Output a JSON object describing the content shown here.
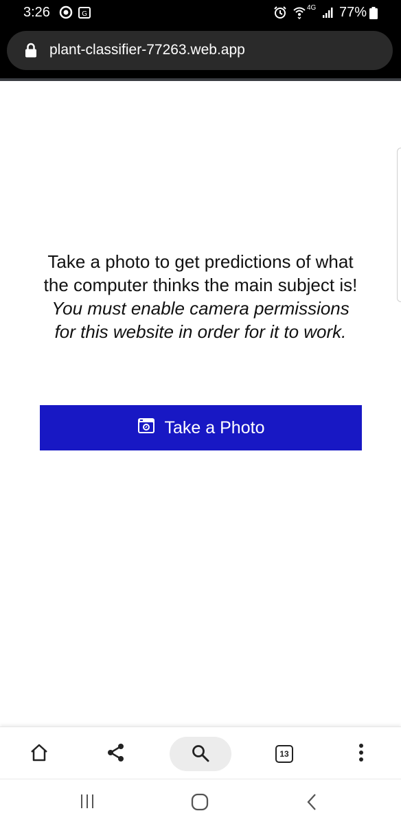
{
  "status_bar": {
    "time": "3:26",
    "network": "4G",
    "battery": "77%"
  },
  "browser": {
    "url": "plant-classifier-77263.web.app",
    "tab_count": "13"
  },
  "main": {
    "intro_text": "Take a photo to get predictions of what the computer thinks the main subject is!",
    "intro_note": "You must enable camera permissions for this website in order for it to work.",
    "button_label": "Take a Photo"
  },
  "colors": {
    "button_bg": "#1818c4",
    "status_bg": "#000000"
  },
  "icons": {
    "toolbar": [
      "home-icon",
      "share-icon",
      "search-icon",
      "tabs-icon",
      "more-icon"
    ],
    "nav": [
      "recents-icon",
      "home-nav-icon",
      "back-icon"
    ]
  }
}
